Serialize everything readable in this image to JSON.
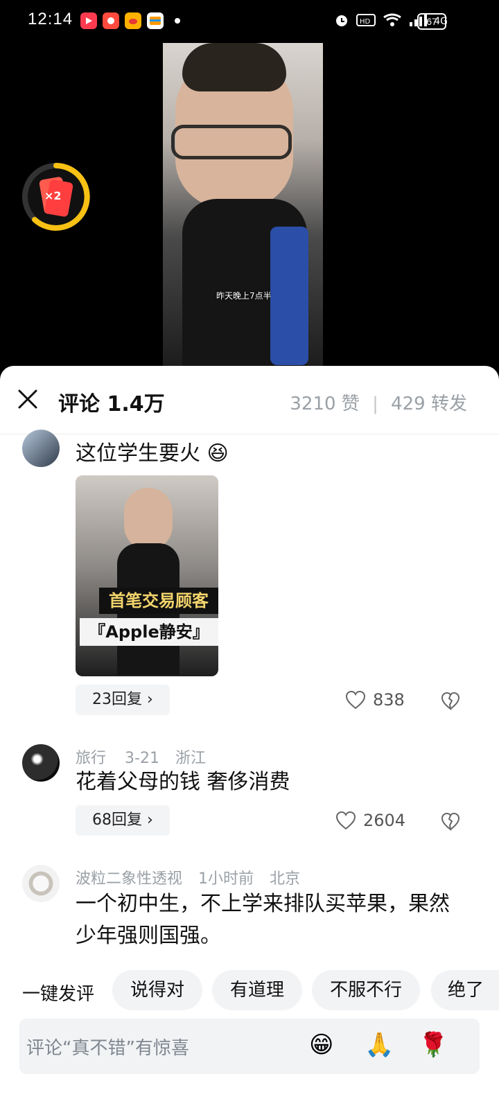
{
  "status_bar": {
    "time": "12:14",
    "battery": "67",
    "network": "4G",
    "hd": "HD2"
  },
  "video": {
    "caption": "昨天晚上7点半"
  },
  "reward": {
    "label": "×2"
  },
  "comments_sheet": {
    "title": "评论 1.4万",
    "likes": "3210 赞",
    "separator": "|",
    "shares": "429 转发",
    "comments": [
      {
        "text": "这位学生要火",
        "emoji": "😆",
        "replies": "23回复",
        "likes": "838",
        "photo_banner_1": "首笔交易顾客",
        "photo_banner_2": "『Apple静安』"
      },
      {
        "user": "旅行",
        "date": "3-21",
        "location": "浙江",
        "text": "花着父母的钱 奢侈消费",
        "replies": "68回复",
        "likes": "2604"
      },
      {
        "user": "波粒二象性透视",
        "date": "1小时前",
        "location": "北京",
        "text_line1": "一个初中生，不上学来排队买苹果，果然",
        "text_line2": "少年强则国强。"
      }
    ],
    "quick": {
      "label": "一键发评",
      "chips": [
        "说得对",
        "有道理",
        "不服不行",
        "绝了"
      ]
    },
    "input": {
      "placeholder": "评论“真不错”有惊喜",
      "emojis": [
        "😁",
        "🙏",
        "🌹"
      ]
    }
  }
}
